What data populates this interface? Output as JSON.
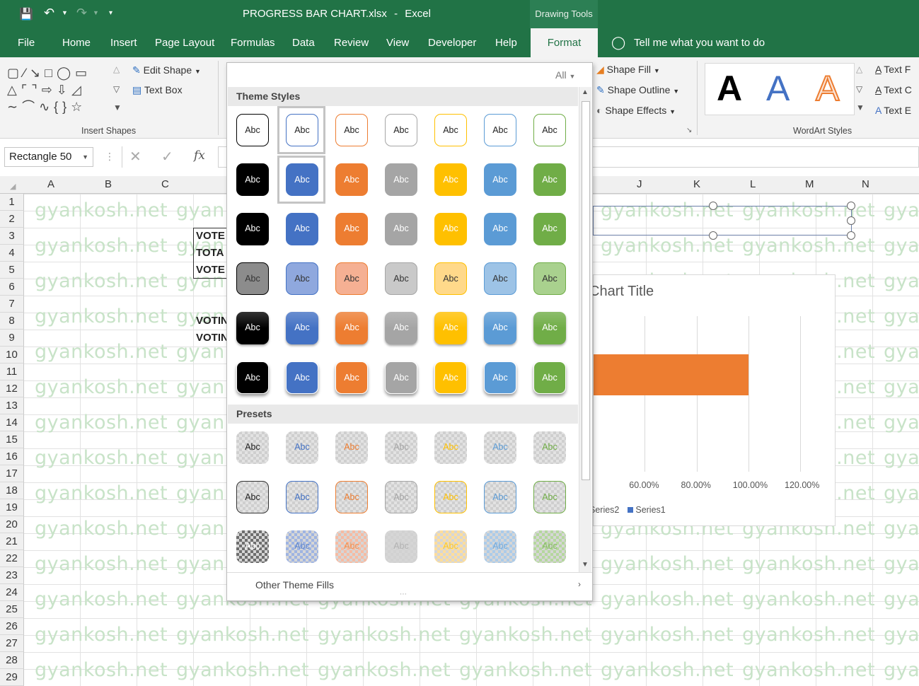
{
  "title": {
    "filename": "PROGRESS BAR CHART.xlsx",
    "separator": "-",
    "app": "Excel",
    "context_tab": "Drawing Tools"
  },
  "tabs": [
    "File",
    "Home",
    "Insert",
    "Page Layout",
    "Formulas",
    "Data",
    "Review",
    "View",
    "Developer",
    "Help",
    "Format"
  ],
  "tell_me": "Tell me what you want to do",
  "ribbon": {
    "insert_shapes_label": "Insert Shapes",
    "edit_shape": "Edit Shape",
    "text_box": "Text Box",
    "shape_fill": "Shape Fill",
    "shape_outline": "Shape Outline",
    "shape_effects": "Shape Effects",
    "wordart_label": "WordArt Styles",
    "wordart_letter": "A",
    "text_fill": "Text F",
    "text_outline": "Text C",
    "text_effects": "Text E"
  },
  "formula_bar": {
    "name_box": "Rectangle 50",
    "fx": "fx"
  },
  "columns_left": [
    "A",
    "B",
    "C"
  ],
  "columns_right": [
    "J",
    "K",
    "L",
    "M",
    "N"
  ],
  "rows": [
    "1",
    "2",
    "3",
    "4",
    "5",
    "6",
    "7",
    "8",
    "9",
    "10",
    "11",
    "12",
    "13",
    "14",
    "15",
    "16",
    "17",
    "18",
    "19",
    "20",
    "21",
    "22",
    "23",
    "24",
    "25",
    "26",
    "27",
    "28",
    "29"
  ],
  "cells": {
    "c3": "VOTE",
    "c4": "TOTA",
    "c5": "VOTE",
    "c8": "VOTIN",
    "c9": "VOTIN"
  },
  "watermark": "gyankosh.net",
  "panel": {
    "filter": "All",
    "theme_styles_label": "Theme Styles",
    "presets_label": "Presets",
    "swatch_text": "Abc",
    "other_fills": "Other Theme Fills",
    "colors": [
      "#000000",
      "#4472c4",
      "#ed7d31",
      "#a5a5a5",
      "#ffc000",
      "#5b9bd5",
      "#70ad47"
    ]
  },
  "chart": {
    "title": "Chart Title",
    "legend": [
      "Series2",
      "Series1"
    ],
    "series_colors": {
      "Series1": "#4472c4",
      "Series2": "#ed7d31"
    }
  },
  "chart_data": {
    "type": "bar",
    "orientation": "horizontal",
    "title": "Chart Title",
    "x_tick_labels": [
      "60.00%",
      "80.00%",
      "100.00%",
      "120.00%"
    ],
    "xlim": [
      0.4,
      1.2
    ],
    "series": [
      {
        "name": "Series2",
        "values": [
          1.0
        ]
      }
    ],
    "legend": [
      "Series2",
      "Series1"
    ],
    "legend_position": "bottom",
    "grid": true
  }
}
